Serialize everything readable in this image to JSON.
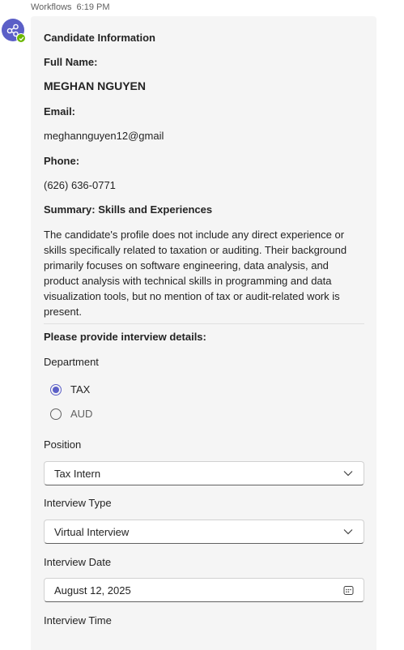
{
  "header": {
    "app_name": "Workflows",
    "time": "6:19 PM"
  },
  "avatar": {
    "icon": "workflow-share-icon",
    "status": "available"
  },
  "card": {
    "candidate_heading": "Candidate Information",
    "full_name_label": "Full Name:",
    "full_name_value": "MEGHAN NGUYEN",
    "email_label": "Email:",
    "email_value": "meghannguyen12@gmail",
    "phone_label": "Phone:",
    "phone_value": "(626) 636-0771",
    "summary_label": "Summary: Skills and Experiences",
    "summary_text": "The candidate's profile does not include any direct experience or skills specifically related to taxation or auditing. Their background primarily focuses on software engineering, data analysis, and product analysis with technical skills in programming and data visualization tools, but no mention of tax or audit-related work is present.",
    "interview_heading": "Please provide interview details:",
    "department": {
      "label": "Department",
      "options": [
        {
          "label": "TAX",
          "checked": true
        },
        {
          "label": "AUD",
          "checked": false
        }
      ]
    },
    "position": {
      "label": "Position",
      "value": "Tax Intern"
    },
    "interview_type": {
      "label": "Interview Type",
      "value": "Virtual Interview"
    },
    "interview_date": {
      "label": "Interview Date",
      "value": "August 12, 2025"
    },
    "interview_time": {
      "label": "Interview Time"
    }
  },
  "colors": {
    "accent": "#5b5fc7",
    "presence": "#6bb700",
    "card_bg": "#f5f5f5"
  }
}
